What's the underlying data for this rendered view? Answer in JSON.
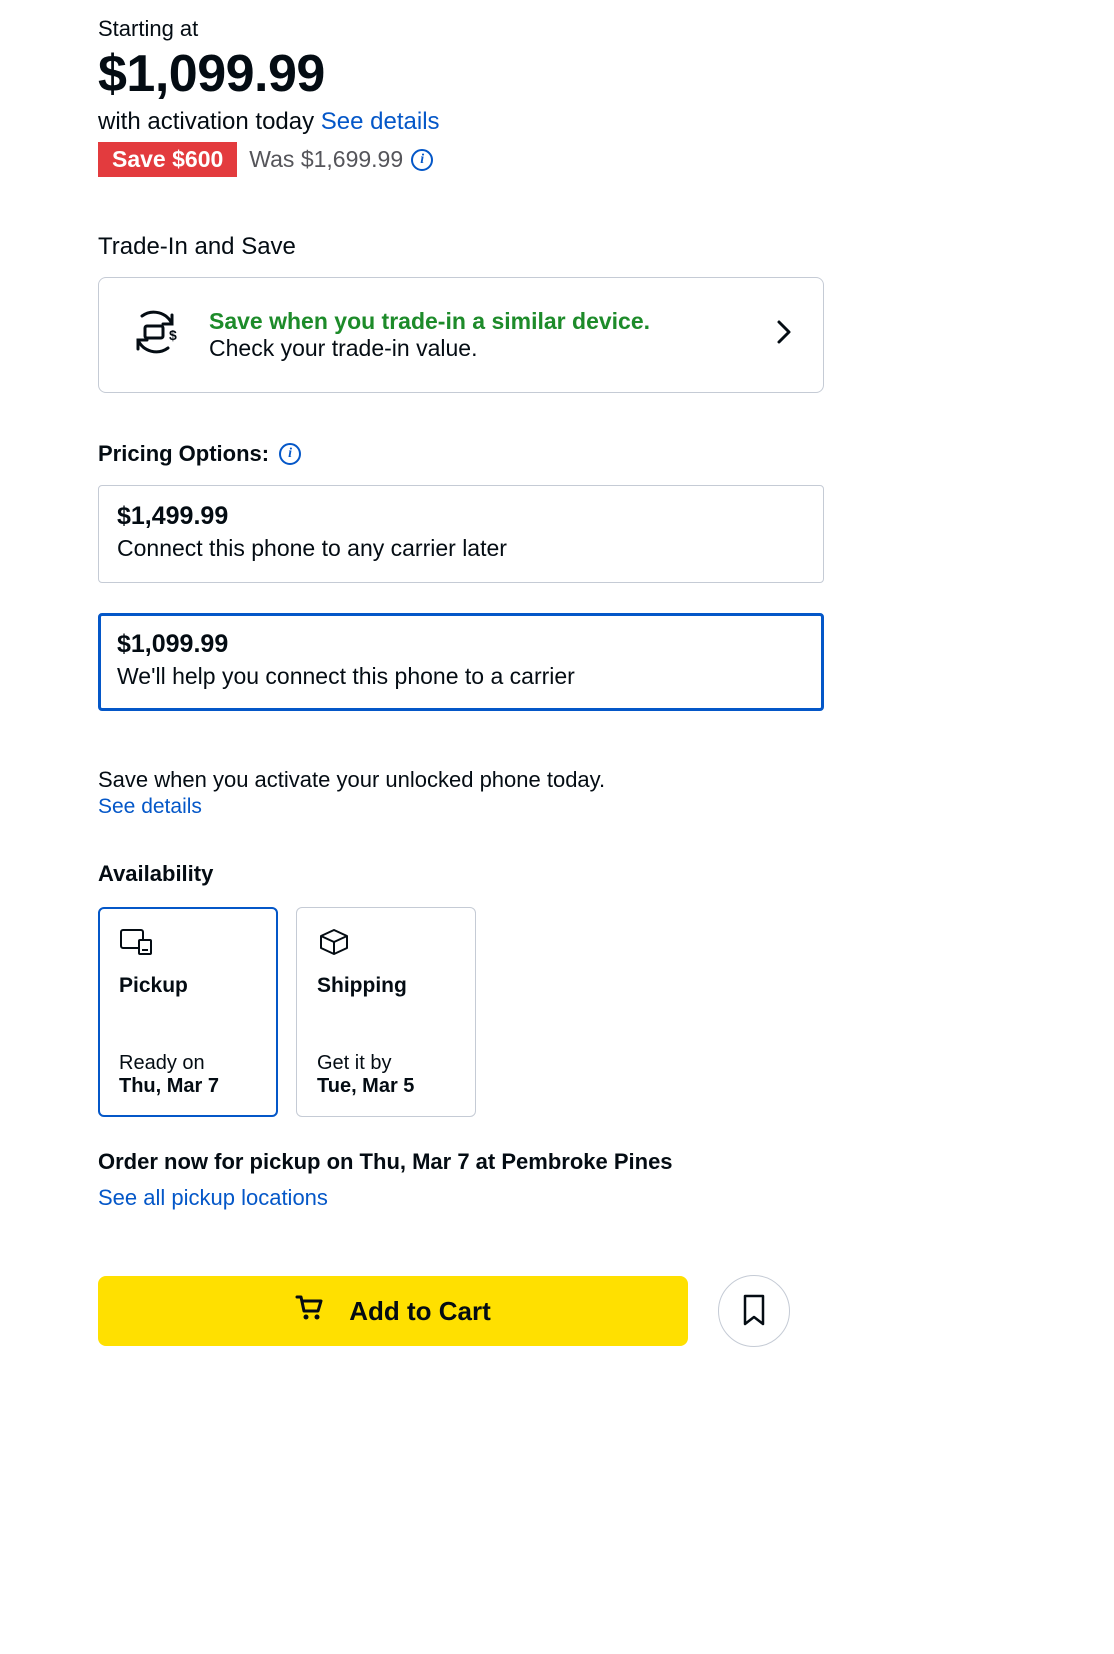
{
  "pricing": {
    "starting_at_label": "Starting at",
    "price": "$1,099.99",
    "activation_text": "with activation today",
    "see_details": "See details",
    "save_badge": "Save $600",
    "was_text": "Was $1,699.99"
  },
  "tradein": {
    "heading": "Trade-In and Save",
    "title": "Save when you trade-in a similar device.",
    "subtitle": "Check your trade-in value."
  },
  "pricing_options": {
    "heading": "Pricing Options:",
    "options": [
      {
        "price": "$1,499.99",
        "desc": "Connect this phone to any carrier later",
        "selected": false
      },
      {
        "price": "$1,099.99",
        "desc": "We'll help you connect this phone to a carrier",
        "selected": true
      }
    ],
    "activation_note": "Save when you activate your unlocked phone today.",
    "see_details": "See details"
  },
  "availability": {
    "heading": "Availability",
    "options": [
      {
        "label": "Pickup",
        "status": "Ready on",
        "date": "Thu, Mar 7",
        "selected": true,
        "icon": "store"
      },
      {
        "label": "Shipping",
        "status": "Get it by",
        "date": "Tue, Mar 5",
        "selected": false,
        "icon": "box"
      }
    ],
    "pickup_summary": "Order now for pickup on Thu, Mar 7 at Pembroke Pines",
    "see_all": "See all pickup locations"
  },
  "cta": {
    "add_to_cart": "Add to Cart"
  }
}
